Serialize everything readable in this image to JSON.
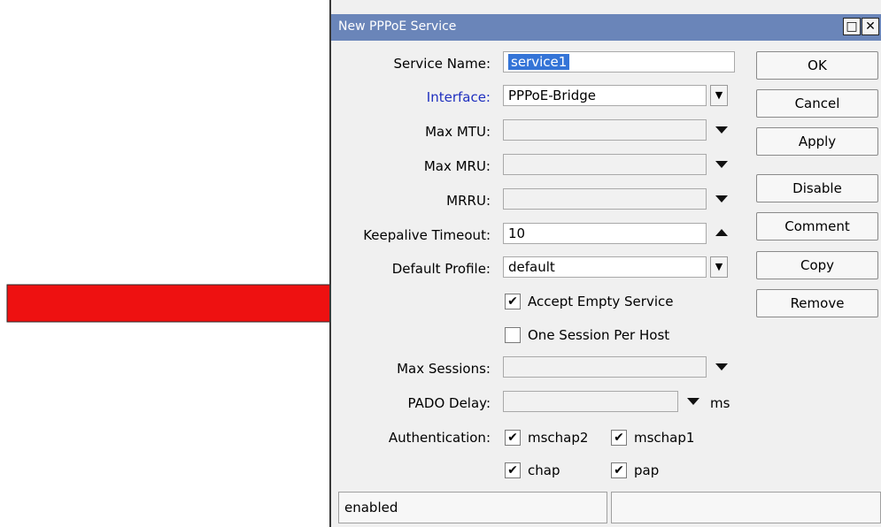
{
  "colors": {
    "titlebar": "#6a85b9",
    "arrow": "#ee1111",
    "link_label": "#1f2fbf",
    "selection": "#3474d7"
  },
  "window": {
    "title": "New PPPoE Service",
    "restore_icon": "restore-icon",
    "close_icon": "close-icon"
  },
  "form": {
    "service_name": {
      "label": "Service Name:",
      "value": "service1"
    },
    "interface": {
      "label": "Interface:",
      "value": "PPPoE-Bridge"
    },
    "max_mtu": {
      "label": "Max MTU:",
      "value": ""
    },
    "max_mru": {
      "label": "Max MRU:",
      "value": ""
    },
    "mrru": {
      "label": "MRRU:",
      "value": ""
    },
    "keepalive": {
      "label": "Keepalive Timeout:",
      "value": "10"
    },
    "default_profile": {
      "label": "Default Profile:",
      "value": "default"
    },
    "accept_empty_service": {
      "label": "Accept Empty Service",
      "checked": true
    },
    "one_session_per_host": {
      "label": "One Session Per Host",
      "checked": false
    },
    "max_sessions": {
      "label": "Max Sessions:",
      "value": ""
    },
    "pado_delay": {
      "label": "PADO Delay:",
      "value": "",
      "unit": "ms"
    },
    "authentication": {
      "label": "Authentication:",
      "options": [
        {
          "label": "mschap2",
          "checked": true
        },
        {
          "label": "mschap1",
          "checked": true
        },
        {
          "label": "chap",
          "checked": true
        },
        {
          "label": "pap",
          "checked": true
        }
      ]
    }
  },
  "buttons": {
    "ok": "OK",
    "cancel": "Cancel",
    "apply": "Apply",
    "disable": "Disable",
    "comment": "Comment",
    "copy": "Copy",
    "remove": "Remove"
  },
  "status_bar": {
    "left": "enabled",
    "right": ""
  },
  "checkmark": "✔",
  "dropdown_glyph": "▼"
}
